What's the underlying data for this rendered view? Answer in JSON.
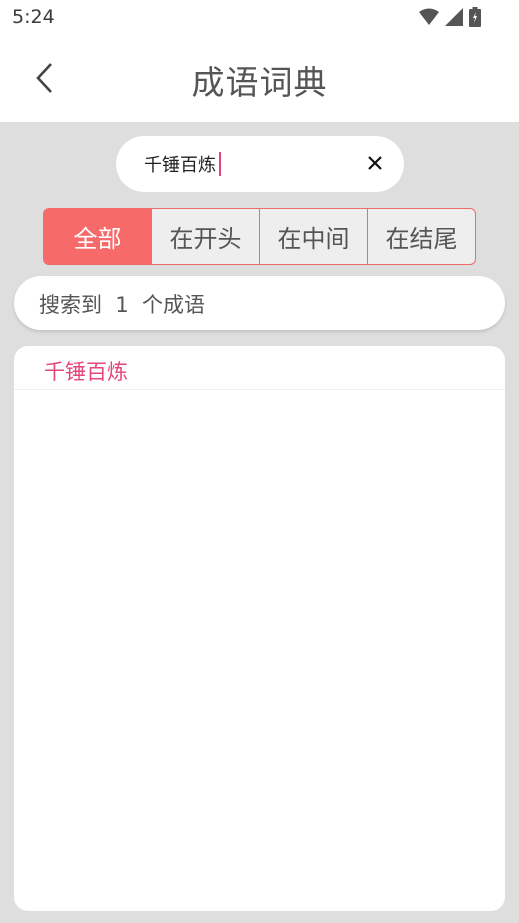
{
  "status_bar": {
    "time": "5:24"
  },
  "app_bar": {
    "title": "成语词典"
  },
  "search": {
    "value": "千锤百炼"
  },
  "filters": [
    {
      "label": "全部",
      "active": true
    },
    {
      "label": "在开头",
      "active": false
    },
    {
      "label": "在中间",
      "active": false
    },
    {
      "label": "在结尾",
      "active": false
    }
  ],
  "result": {
    "summary": "搜索到  1  个成语"
  },
  "results_list": [
    {
      "idiom": "千锤百炼"
    }
  ],
  "colors": {
    "accent": "#f66a6a",
    "idiom_text": "#e4467e",
    "background": "#dedede"
  }
}
